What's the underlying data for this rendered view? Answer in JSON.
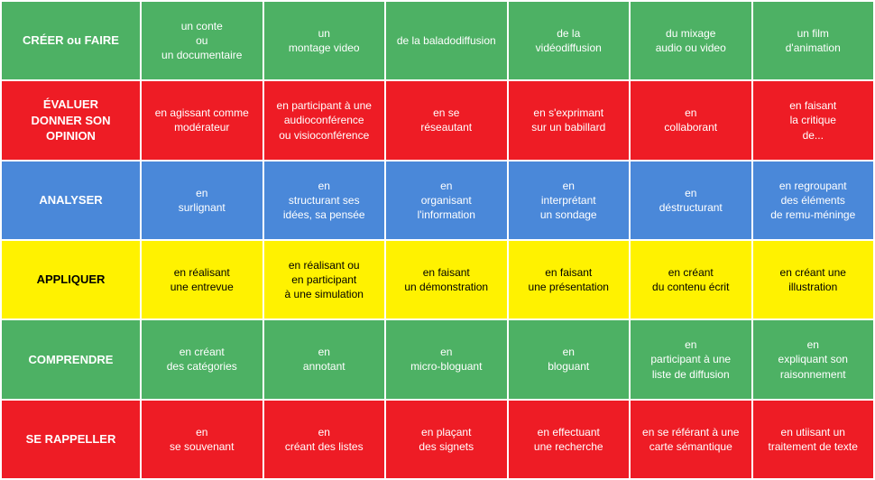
{
  "colors": {
    "green": "#4db164",
    "red": "#ee1c25",
    "blue": "#4a88d9",
    "yellow": "#fff200"
  },
  "rows": [
    {
      "id": "creer",
      "color": "green",
      "label": "CRÉER ou FAIRE",
      "cells": [
        "un conte\nou\nun documentaire",
        "un\nmontage video",
        "de la baladodiffusion",
        "de la\nvidéodiffusion",
        "du mixage\naudio ou video",
        "un film\nd'animation"
      ]
    },
    {
      "id": "evaluer",
      "color": "red",
      "label": "ÉVALUER\nDONNER SON\nOPINION",
      "cells": [
        "en agissant comme\nmodérateur",
        "en participant à une\naudioconférence\nou visioconférence",
        "en se\nréseautant",
        "en s'exprimant\nsur un babillard",
        "en\ncollaborant",
        "en faisant\nla critique\nde..."
      ]
    },
    {
      "id": "analyser",
      "color": "blue",
      "label": "ANALYSER",
      "cells": [
        "en\nsurlignant",
        "en\nstructurant ses\nidées, sa pensée",
        "en\norganisant\nl'information",
        "en\ninterprétant\nun sondage",
        "en\ndéstructurant",
        "en regroupant\ndes éléments\nde remu-méninge"
      ]
    },
    {
      "id": "appliquer",
      "color": "yellow",
      "label": "APPLIQUER",
      "cells": [
        "en réalisant\nune entrevue",
        "en réalisant ou\nen participant\nà une simulation",
        "en faisant\nun démonstration",
        "en faisant\nune présentation",
        "en créant\ndu contenu écrit",
        "en créant une\nillustration"
      ]
    },
    {
      "id": "comprendre",
      "color": "green",
      "label": "COMPRENDRE",
      "cells": [
        "en créant\ndes catégories",
        "en\nannotant",
        "en\nmicro-bloguant",
        "en\nbloguant",
        "en\nparticipant à une\nliste de diffusion",
        "en\nexpliquant son\nraisonnement"
      ]
    },
    {
      "id": "rappeller",
      "color": "red",
      "label": "SE RAPPELLER",
      "cells": [
        "en\nse souvenant",
        "en\ncréant des listes",
        "en plaçant\ndes signets",
        "en effectuant\nune recherche",
        "en se référant à une\ncarte sémantique",
        "en utiisant un\ntraitement de texte"
      ]
    }
  ]
}
